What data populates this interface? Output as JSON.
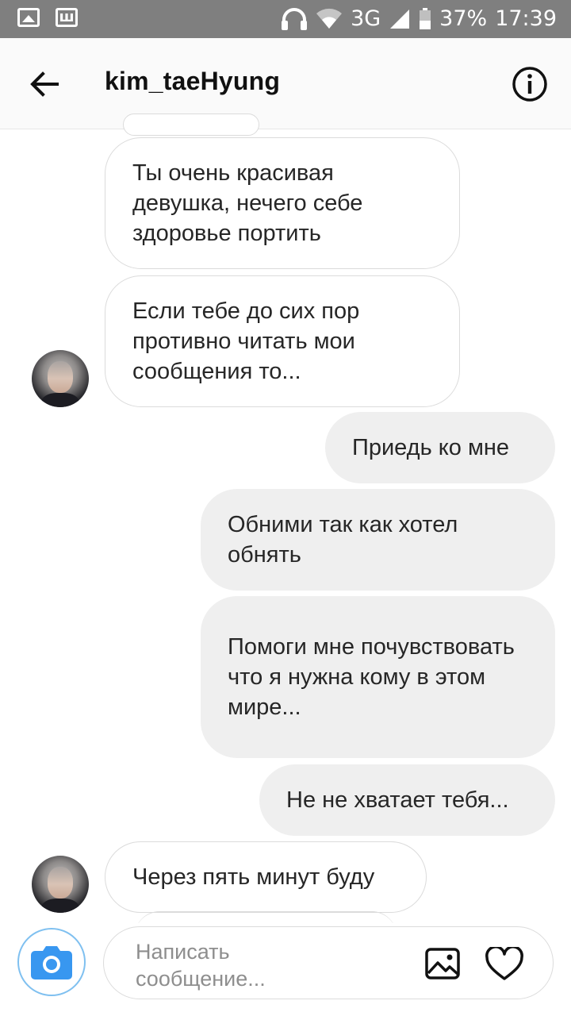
{
  "status_bar": {
    "network": "3G",
    "battery": "37%",
    "time": "17:39"
  },
  "header": {
    "username": "kim_taeHyung"
  },
  "messages": [
    {
      "from": "them",
      "text": "Ты очень красивая девушка, нечего себе здоровье портить"
    },
    {
      "from": "them",
      "text": "Если тебе до сих пор противно читать мои сообщения то..."
    },
    {
      "from": "me",
      "text": "Приедь ко мне"
    },
    {
      "from": "me",
      "text": "Обними так как хотел обнять"
    },
    {
      "from": "me",
      "text": "Помоги мне почувствовать что я нужна кому в этом мире..."
    },
    {
      "from": "me",
      "text": "Не не хватает тебя..."
    },
    {
      "from": "them",
      "text": "Через пять минут буду"
    }
  ],
  "composer": {
    "placeholder": "Написать сообщение..."
  },
  "icons": {
    "back": "arrow-left-icon",
    "info": "info-icon",
    "camera": "camera-icon",
    "gallery": "image-icon",
    "heart": "heart-icon"
  },
  "colors": {
    "accent_blue": "#3897f0",
    "status_bar": "#7f7f7f",
    "incoming_border": "#dbdbdb",
    "outgoing_bg": "#efefef"
  }
}
